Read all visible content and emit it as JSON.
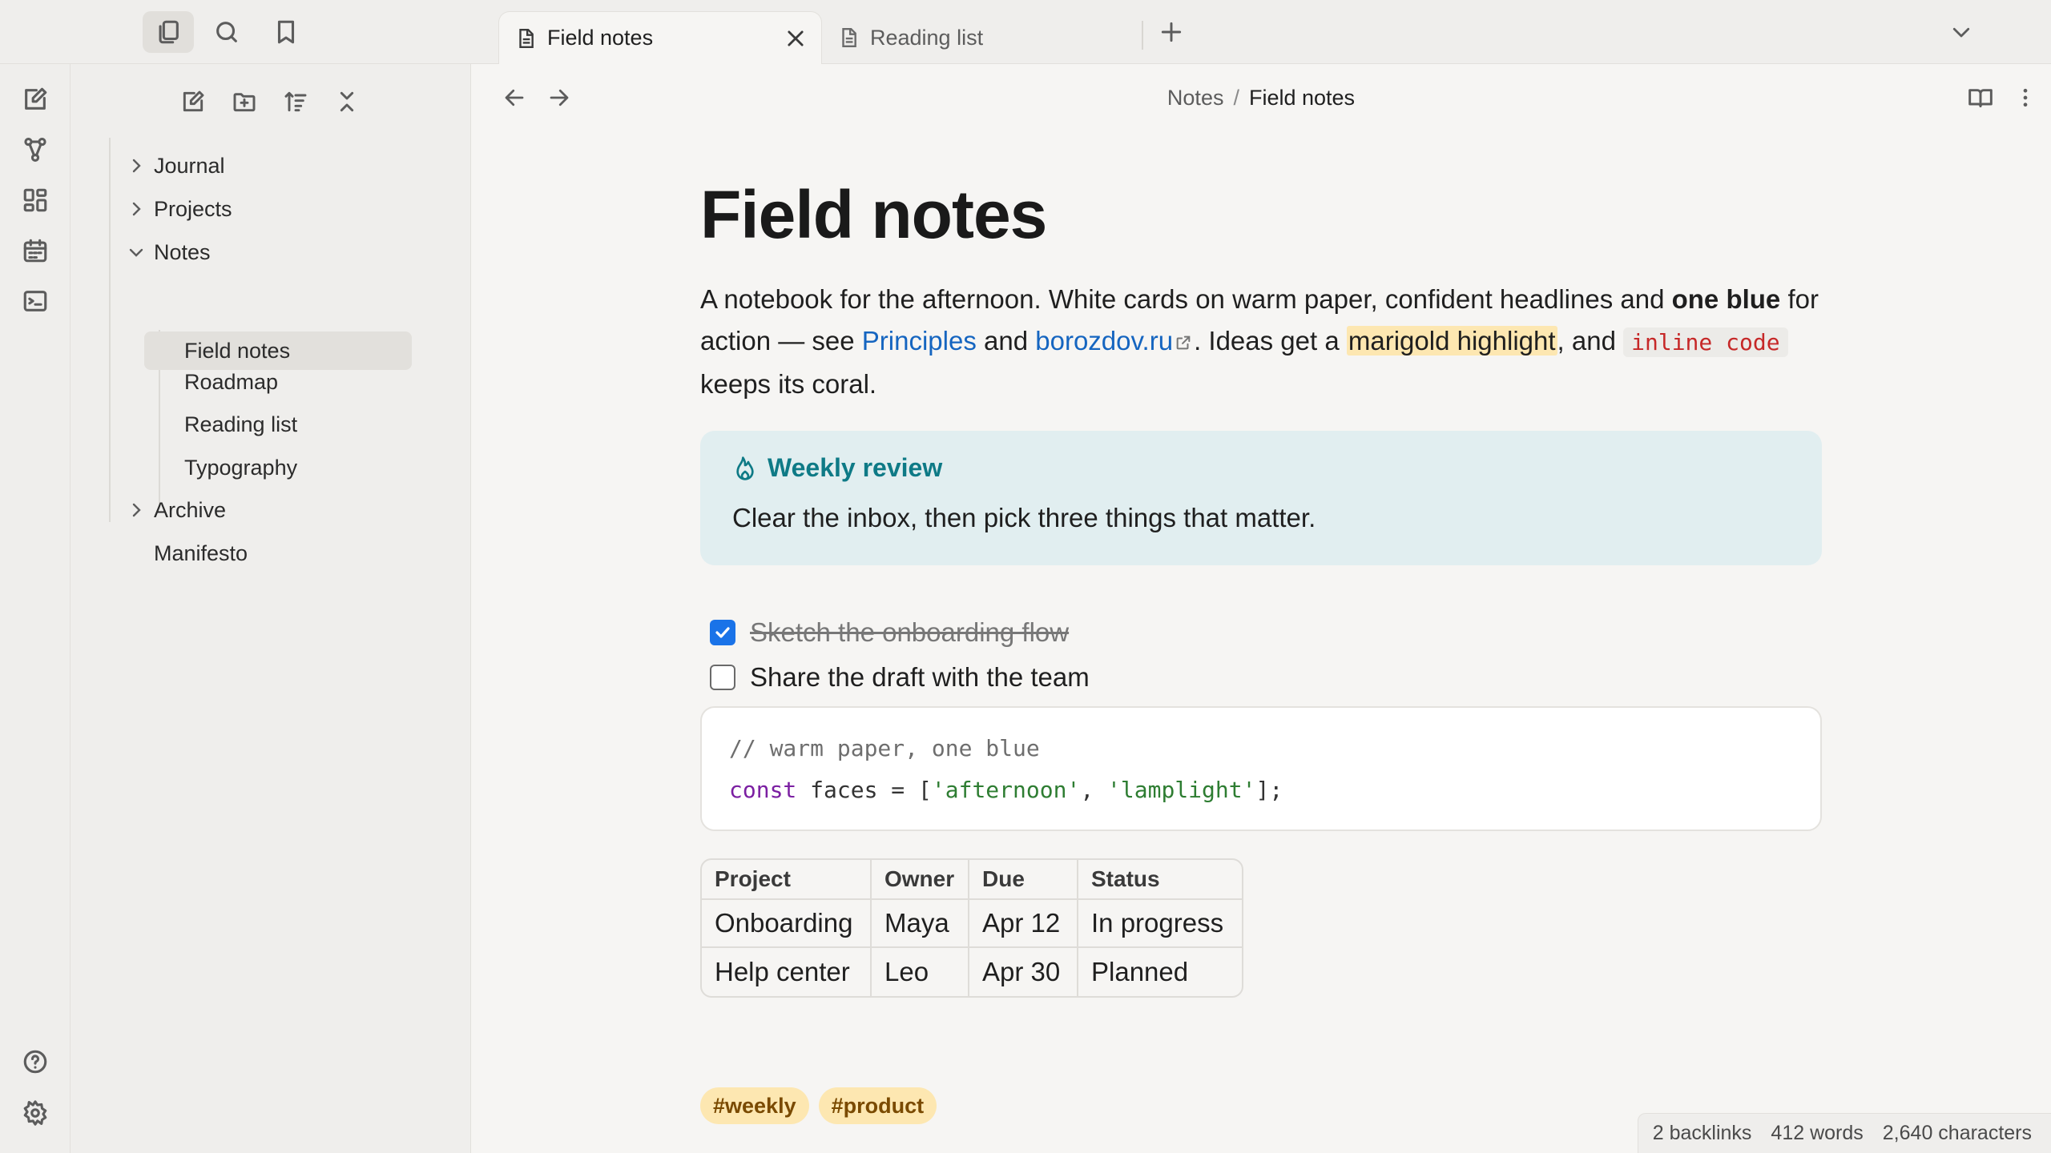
{
  "tabs": [
    {
      "label": "Field notes",
      "active": true
    },
    {
      "label": "Reading list",
      "active": false
    }
  ],
  "breadcrumb": {
    "parent": "Notes",
    "separator": "/",
    "current": "Field notes"
  },
  "sidebar": {
    "tree": [
      {
        "label": "Journal",
        "type": "folder",
        "expanded": false
      },
      {
        "label": "Projects",
        "type": "folder",
        "expanded": false
      },
      {
        "label": "Notes",
        "type": "folder",
        "expanded": true
      },
      {
        "label": "Field notes",
        "type": "file",
        "selected": true
      },
      {
        "label": "Roadmap",
        "type": "file"
      },
      {
        "label": "Reading list",
        "type": "file"
      },
      {
        "label": "Typography",
        "type": "file"
      },
      {
        "label": "Archive",
        "type": "folder",
        "expanded": false
      },
      {
        "label": "Manifesto",
        "type": "file"
      }
    ]
  },
  "document": {
    "title": "Field notes",
    "intro": {
      "t1": "A notebook for the afternoon. White cards on warm paper, confident headlines and ",
      "bold": "one blue",
      "t2": " for action — see ",
      "link1": "Principles",
      "t3": " and ",
      "link2": "borozdov.ru",
      "t4": ". Ideas get a ",
      "highlight": "marigold highlight",
      "t5": ", and ",
      "code": "inline code",
      "t6": " keeps its coral."
    },
    "callout": {
      "title": "Weekly review",
      "body": "Clear the inbox, then pick three things that matter."
    },
    "tasks": [
      {
        "text": "Sketch the onboarding flow",
        "done": true
      },
      {
        "text": "Share the draft with the team",
        "done": false
      }
    ],
    "code": {
      "comment": "// warm paper, one blue",
      "keyword": "const",
      "mid": " faces = [",
      "str1": "'afternoon'",
      "comma": ", ",
      "str2": "'lamplight'",
      "end": "];"
    },
    "table": {
      "headers": [
        "Project",
        "Owner",
        "Due",
        "Status"
      ],
      "rows": [
        [
          "Onboarding",
          "Maya",
          "Apr 12",
          "In progress"
        ],
        [
          "Help center",
          "Leo",
          "Apr 30",
          "Planned"
        ]
      ]
    },
    "tags": [
      "#weekly",
      "#product"
    ]
  },
  "status": {
    "backlinks": "2 backlinks",
    "words": "412 words",
    "characters": "2,640 characters"
  },
  "colors": {
    "accent": "#1a73e8",
    "link": "#1565c0",
    "highlight": "#fde7b1",
    "code": "#c62828",
    "callout_bg": "#e1eef0",
    "callout_title": "#0e7a86",
    "paper": "#f6f5f3"
  },
  "icons": {
    "topbar": [
      "files-icon",
      "search-icon",
      "bookmark-icon"
    ],
    "ribbon": [
      "new-note-icon",
      "graph-icon",
      "canvas-icon",
      "calendar-icon",
      "terminal-icon",
      "help-icon",
      "settings-icon"
    ],
    "sidebar_actions": [
      "new-note-icon",
      "new-folder-icon",
      "sort-icon",
      "collapse-all-icon"
    ]
  }
}
